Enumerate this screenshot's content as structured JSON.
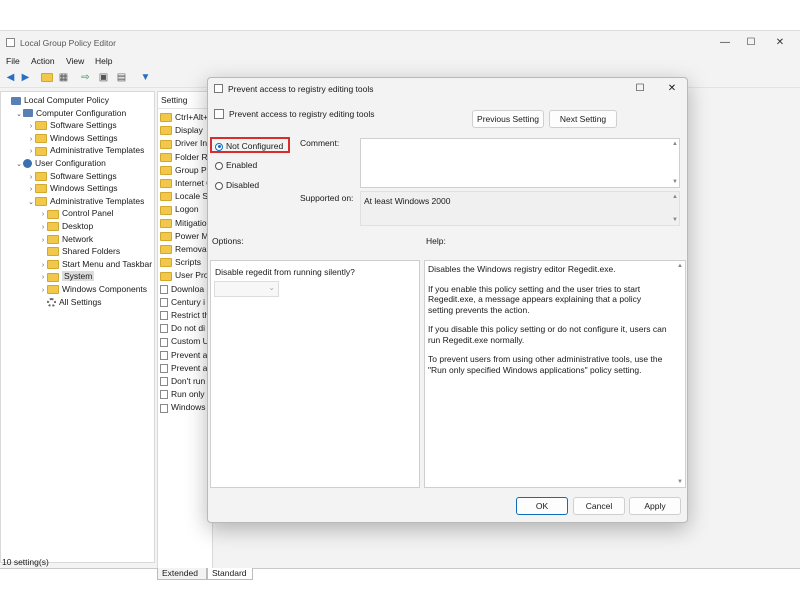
{
  "window": {
    "title": "Local Group Policy Editor",
    "caption_min": "—",
    "caption_max": "☐",
    "caption_close": "✕"
  },
  "menu": [
    "File",
    "Action",
    "View",
    "Help"
  ],
  "tree": [
    {
      "label": "Local Computer Policy",
      "icon": "computer-icon",
      "indent": 0,
      "exp": ""
    },
    {
      "label": "Computer Configuration",
      "icon": "computer-icon",
      "indent": 1,
      "exp": "v"
    },
    {
      "label": "Software Settings",
      "icon": "folder-icon",
      "indent": 2,
      "exp": ">"
    },
    {
      "label": "Windows Settings",
      "icon": "folder-icon",
      "indent": 2,
      "exp": ">"
    },
    {
      "label": "Administrative Templates",
      "icon": "folder-icon",
      "indent": 2,
      "exp": ">"
    },
    {
      "label": "User Configuration",
      "icon": "user-icon",
      "indent": 1,
      "exp": "v"
    },
    {
      "label": "Software Settings",
      "icon": "folder-icon",
      "indent": 2,
      "exp": ">"
    },
    {
      "label": "Windows Settings",
      "icon": "folder-icon",
      "indent": 2,
      "exp": ">"
    },
    {
      "label": "Administrative Templates",
      "icon": "folder-icon",
      "indent": 2,
      "exp": "v"
    },
    {
      "label": "Control Panel",
      "icon": "folder-icon",
      "indent": 3,
      "exp": ">"
    },
    {
      "label": "Desktop",
      "icon": "folder-icon",
      "indent": 3,
      "exp": ">"
    },
    {
      "label": "Network",
      "icon": "folder-icon",
      "indent": 3,
      "exp": ">"
    },
    {
      "label": "Shared Folders",
      "icon": "folder-icon",
      "indent": 3,
      "exp": ""
    },
    {
      "label": "Start Menu and Taskbar",
      "icon": "folder-icon",
      "indent": 3,
      "exp": ">"
    },
    {
      "label": "System",
      "icon": "folder-icon",
      "indent": 3,
      "exp": ">",
      "selected": true
    },
    {
      "label": "Windows Components",
      "icon": "folder-icon",
      "indent": 3,
      "exp": ">"
    },
    {
      "label": "All Settings",
      "icon": "settings-icon",
      "indent": 3,
      "exp": ""
    }
  ],
  "list": {
    "header": "Setting",
    "rows": [
      "Ctrl+Alt+",
      "Display",
      "Driver Ins",
      "Folder Re",
      "Group Po",
      "Internet C",
      "Locale Se",
      "Logon",
      "Mitigation",
      "Power Ma",
      "Removab",
      "Scripts",
      "User Profi",
      "Downloa",
      "Century i",
      "Restrict th",
      "Do not di",
      "Custom U",
      "Prevent a",
      "Prevent a",
      "Don't run",
      "Run only",
      "Windows"
    ]
  },
  "tabs": [
    "Extended",
    "Standard"
  ],
  "status": "10 setting(s)",
  "dialog": {
    "title": "Prevent access to registry editing tools",
    "header": "Prevent access to registry editing tools",
    "previous_button": "Previous Setting",
    "next_button": "Next Setting",
    "options": [
      {
        "label": "Not Configured",
        "selected": true
      },
      {
        "label": "Enabled",
        "selected": false
      },
      {
        "label": "Disabled",
        "selected": false
      }
    ],
    "comment_label": "Comment:",
    "supported_label": "Supported on:",
    "supported_value": "At least Windows 2000",
    "options_label": "Options:",
    "help_label": "Help:",
    "option_text": "Disable regedit from running silently?",
    "help_paragraphs": [
      "Disables the Windows registry editor Regedit.exe.",
      "If you enable this policy setting and the user tries to start Regedit.exe, a message appears explaining that a policy setting prevents the action.",
      "If you disable this policy setting or do not configure it, users can run Regedit.exe normally.",
      "To prevent users from using other administrative tools, use the \"Run only specified Windows applications\" policy setting."
    ],
    "ok_button": "OK",
    "cancel_button": "Cancel",
    "apply_button": "Apply",
    "caption_max": "☐",
    "caption_close": "✕"
  },
  "colors": {
    "highlight_box": "#d92c2c",
    "accent": "#0f6cbd",
    "folder": "#f1c84c"
  }
}
